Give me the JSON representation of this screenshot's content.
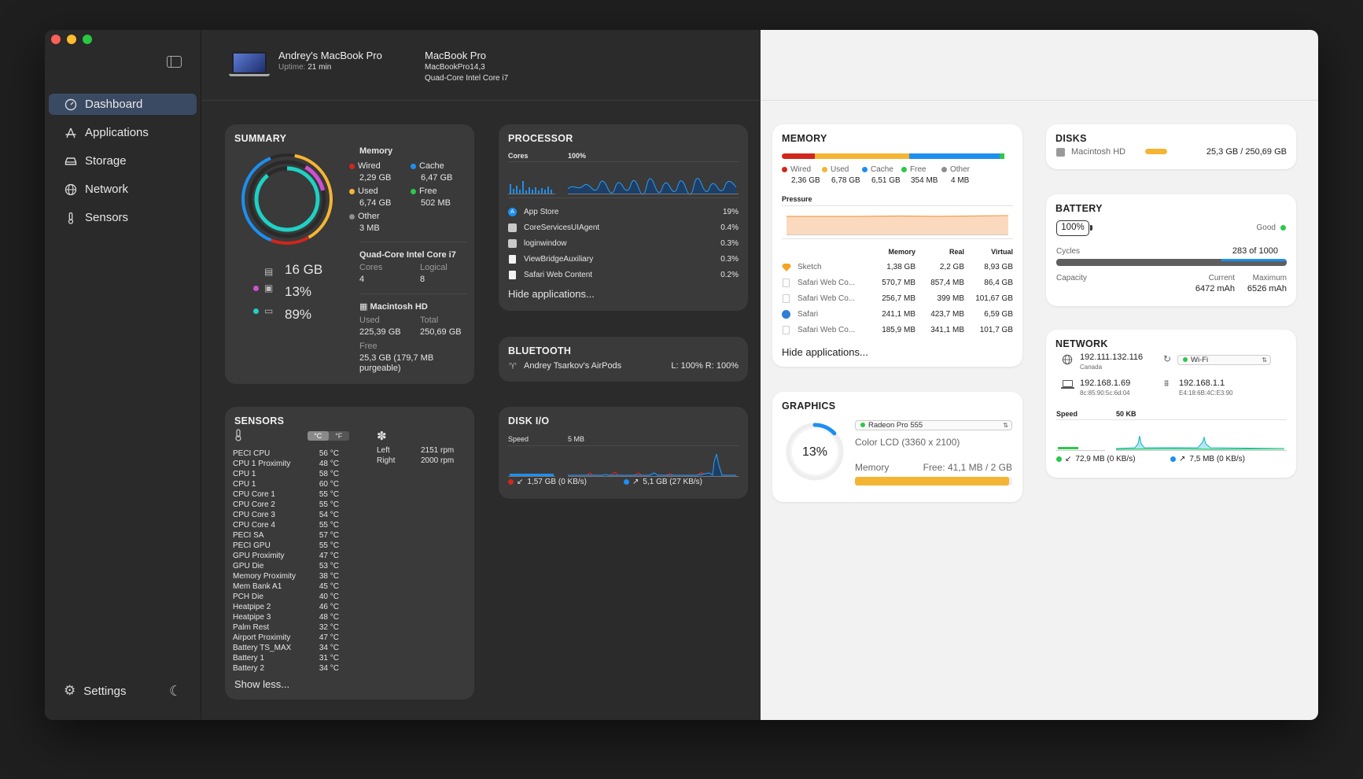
{
  "sidebar": {
    "items": [
      {
        "label": "Dashboard",
        "icon": "gauge-icon",
        "active": true
      },
      {
        "label": "Applications",
        "icon": "apps-icon"
      },
      {
        "label": "Storage",
        "icon": "drive-icon"
      },
      {
        "label": "Network",
        "icon": "globe-icon"
      },
      {
        "label": "Sensors",
        "icon": "thermometer-icon"
      }
    ],
    "settings": "Settings"
  },
  "header": {
    "name": "Andrey's MacBook Pro",
    "uptime_label": "Uptime:",
    "uptime": "21 min",
    "model": "MacBook Pro",
    "model_id": "MacBookPro14,3",
    "cpu": "Quad-Core Intel Core i7"
  },
  "summary": {
    "title": "SUMMARY",
    "memory_title": "Memory",
    "wired_label": "Wired",
    "wired": "2,29 GB",
    "cache_label": "Cache",
    "cache": "6,47 GB",
    "used_label": "Used",
    "used": "6,74 GB",
    "free_label": "Free",
    "free": "502 MB",
    "other_label": "Other",
    "other": "3 MB",
    "cpu_title": "Quad-Core Intel Core i7",
    "cores_label": "Cores",
    "cores": "4",
    "logical_label": "Logical",
    "logical": "8",
    "disk_title": "Macintosh HD",
    "disk_used_label": "Used",
    "disk_used": "225,39 GB",
    "disk_total_label": "Total",
    "disk_total": "250,69 GB",
    "disk_free_label": "Free",
    "disk_free": "25,3 GB (179,7 MB purgeable)",
    "stat_mem": "16 GB",
    "stat_cpu": "13%",
    "stat_disk": "89%"
  },
  "processor": {
    "title": "PROCESSOR",
    "cores_label": "Cores",
    "usage_label": "100%",
    "apps": [
      {
        "name": "App Store",
        "value": "19%"
      },
      {
        "name": "CoreServicesUIAgent",
        "value": "0.4%"
      },
      {
        "name": "loginwindow",
        "value": "0.3%"
      },
      {
        "name": "ViewBridgeAuxiliary",
        "value": "0.3%"
      },
      {
        "name": "Safari Web Content",
        "value": "0.2%"
      }
    ],
    "hide": "Hide applications..."
  },
  "bluetooth": {
    "title": "BLUETOOTH",
    "device": "Andrey Tsarkov's AirPods",
    "battery": "L: 100% R: 100%"
  },
  "diskio": {
    "title": "DISK I/O",
    "speed_label": "Speed",
    "scale_label": "5 MB",
    "read": "1,57 GB (0 KB/s)",
    "write": "5,1 GB (27 KB/s)"
  },
  "sensors": {
    "title": "SENSORS",
    "unit_c": "°C",
    "unit_f": "°F",
    "fans": [
      {
        "name": "Left",
        "value": "2151 rpm"
      },
      {
        "name": "Right",
        "value": "2000 rpm"
      }
    ],
    "rows": [
      {
        "name": "PECI CPU",
        "value": "56 °C"
      },
      {
        "name": "CPU 1 Proximity",
        "value": "48 °C"
      },
      {
        "name": "CPU 1",
        "value": "58 °C"
      },
      {
        "name": "CPU 1",
        "value": "60 °C"
      },
      {
        "name": "CPU Core 1",
        "value": "55 °C"
      },
      {
        "name": "CPU Core 2",
        "value": "55 °C"
      },
      {
        "name": "CPU Core 3",
        "value": "54 °C"
      },
      {
        "name": "CPU Core 4",
        "value": "55 °C"
      },
      {
        "name": "PECI SA",
        "value": "57 °C"
      },
      {
        "name": "PECI GPU",
        "value": "55 °C"
      },
      {
        "name": "GPU Proximity",
        "value": "47 °C"
      },
      {
        "name": "GPU Die",
        "value": "53 °C"
      },
      {
        "name": "Memory Proximity",
        "value": "38 °C"
      },
      {
        "name": "Mem Bank A1",
        "value": "45 °C"
      },
      {
        "name": "PCH Die",
        "value": "40 °C"
      },
      {
        "name": "Heatpipe 2",
        "value": "46 °C"
      },
      {
        "name": "Heatpipe 3",
        "value": "48 °C"
      },
      {
        "name": "Palm Rest",
        "value": "32 °C"
      },
      {
        "name": "Airport Proximity",
        "value": "47 °C"
      },
      {
        "name": "Battery TS_MAX",
        "value": "34 °C"
      },
      {
        "name": "Battery 1",
        "value": "31 °C"
      },
      {
        "name": "Battery 2",
        "value": "34 °C"
      }
    ],
    "show_less": "Show less..."
  },
  "memory": {
    "title": "MEMORY",
    "legend": [
      {
        "label": "Wired",
        "value": "2,36 GB",
        "color": "#d0271d"
      },
      {
        "label": "Used",
        "value": "6,78 GB",
        "color": "#f4b534"
      },
      {
        "label": "Cache",
        "value": "6,51 GB",
        "color": "#1d8ff0"
      },
      {
        "label": "Free",
        "value": "354 MB",
        "color": "#2bc84c"
      },
      {
        "label": "Other",
        "value": "4 MB",
        "color": "#8e8e8e"
      }
    ],
    "bar_fractions": [
      0.142,
      0.408,
      0.392,
      0.021
    ],
    "pressure_label": "Pressure",
    "col_memory": "Memory",
    "col_real": "Real",
    "col_virtual": "Virtual",
    "apps": [
      {
        "name": "Sketch",
        "memory": "1,38 GB",
        "real": "2,2 GB",
        "virtual": "8,93 GB"
      },
      {
        "name": "Safari Web Co...",
        "memory": "570,7 MB",
        "real": "857,4 MB",
        "virtual": "86,4 GB"
      },
      {
        "name": "Safari Web Co...",
        "memory": "256,7 MB",
        "real": "399 MB",
        "virtual": "101,67 GB"
      },
      {
        "name": "Safari",
        "memory": "241,1 MB",
        "real": "423,7 MB",
        "virtual": "6,59 GB"
      },
      {
        "name": "Safari Web Co...",
        "memory": "185,9 MB",
        "real": "341,1 MB",
        "virtual": "101,7 GB"
      }
    ],
    "hide": "Hide applications..."
  },
  "graphics": {
    "title": "GRAPHICS",
    "usage": "13%",
    "usage_fraction": 0.13,
    "gpu": "Radeon Pro 555",
    "display": "Color LCD (3360 x 2100)",
    "memory_label": "Memory",
    "memory_free": "Free: 41,1 MB / 2 GB",
    "memory_used_fraction": 0.98
  },
  "disks": {
    "title": "DISKS",
    "name": "Macintosh HD",
    "value": "25,3 GB / 250,69 GB"
  },
  "battery": {
    "title": "BATTERY",
    "level": "100%",
    "health": "Good",
    "cycles_label": "Cycles",
    "cycles": "283 of 1000",
    "cycles_fraction": 0.283,
    "capacity_label": "Capacity",
    "current_label": "Current",
    "current": "6472 mAh",
    "maximum_label": "Maximum",
    "maximum": "6526 mAh"
  },
  "network": {
    "title": "NETWORK",
    "public_ip": "192.111.132.116",
    "country": "Canada",
    "interface": "Wi-Fi",
    "local_ip": "192.168.1.69",
    "local_mac": "8c:85:90:5c:6d:04",
    "router_ip": "192.168.1.1",
    "router_mac": "E4:18:6B:4C:E3:90",
    "speed_label": "Speed",
    "scale_label": "50 KB",
    "download": "72,9 MB (0 KB/s)",
    "upload": "7,5 MB (0 KB/s)"
  }
}
